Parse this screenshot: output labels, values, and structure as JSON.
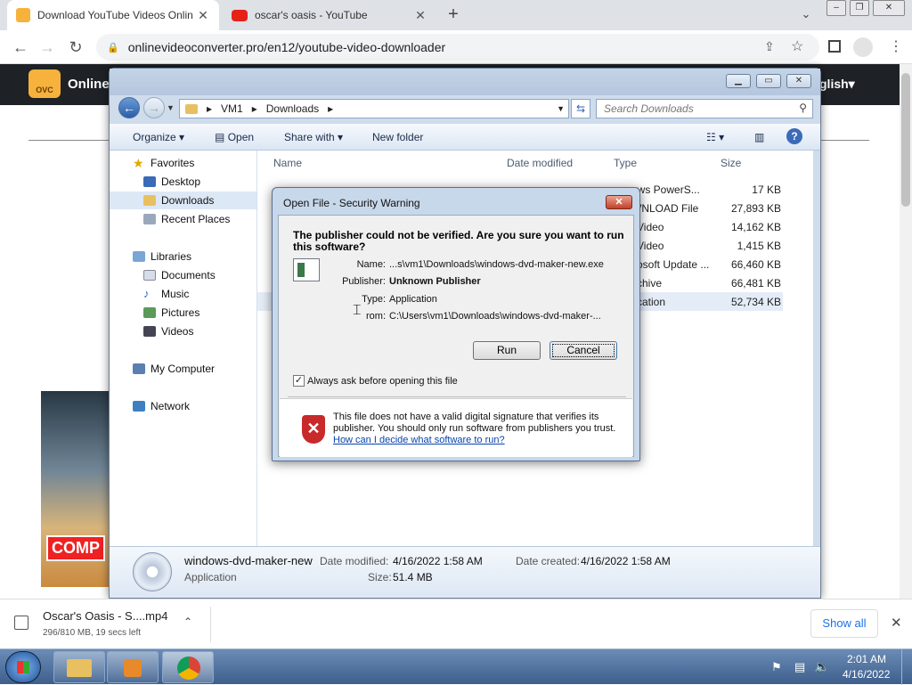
{
  "browser": {
    "tabs": [
      {
        "title": "Download YouTube Videos Onlin"
      },
      {
        "title": "oscar's oasis - YouTube"
      }
    ],
    "new_tab": "+",
    "url": "onlinevideoconverter.pro/en12/youtube-video-downloader",
    "window_controls": [
      "–",
      "❐",
      "✕"
    ]
  },
  "site": {
    "logo_text": "OVC",
    "brand": "Online",
    "lang": "glish",
    "video_label": "COMP"
  },
  "explorer": {
    "path": [
      "VM1",
      "Downloads"
    ],
    "search_placeholder": "Search Downloads",
    "commands": {
      "organize": "Organize",
      "open": "Open",
      "share_with": "Share with",
      "new_folder": "New folder"
    },
    "nav": {
      "favorites": "Favorites",
      "desktop": "Desktop",
      "downloads": "Downloads",
      "recent_places": "Recent Places",
      "libraries": "Libraries",
      "documents": "Documents",
      "music": "Music",
      "pictures": "Pictures",
      "videos": "Videos",
      "my_computer": "My Computer",
      "network": "Network"
    },
    "columns": {
      "name": "Name",
      "date_modified": "Date modified",
      "type": "Type",
      "size": "Size"
    },
    "files": [
      {
        "type": "ows PowerS...",
        "size": "17 KB"
      },
      {
        "type": "WNLOAD File",
        "size": "27,893 KB"
      },
      {
        "type": "Video",
        "size": "14,162 KB"
      },
      {
        "type": "Video",
        "size": "1,415 KB"
      },
      {
        "type": "osoft Update ...",
        "size": "66,460 KB"
      },
      {
        "type": "chive",
        "size": "66,481 KB"
      },
      {
        "type": "cation",
        "size": "52,734 KB"
      }
    ],
    "details": {
      "name": "windows-dvd-maker-new",
      "kind": "Application",
      "date_modified_label": "Date modified:",
      "date_modified": "4/16/2022 1:58 AM",
      "date_created_label": "Date created:",
      "date_created": "4/16/2022 1:58 AM",
      "size_label": "Size:",
      "size": "51.4 MB"
    }
  },
  "dialog": {
    "title": "Open File - Security Warning",
    "question": "The publisher could not be verified.  Are you sure you want to run this software?",
    "name_label": "Name:",
    "name_value": "...s\\vm1\\Downloads\\windows-dvd-maker-new.exe",
    "publisher_label": "Publisher:",
    "publisher_value": "Unknown Publisher",
    "type_label": "Type:",
    "type_value": "Application",
    "from_label": "rom:",
    "from_value": "C:\\Users\\vm1\\Downloads\\windows-dvd-maker-...",
    "run": "Run",
    "cancel": "Cancel",
    "always_ask": "Always ask before opening this file",
    "warning": "This file does not have a valid digital signature that verifies its publisher.  You should only run software from publishers you trust.",
    "help_link": "How can I decide what software to run?"
  },
  "shelf": {
    "file": "Oscar's Oasis - S....mp4",
    "progress": "296/810 MB, 19 secs left",
    "show_all": "Show all"
  },
  "taskbar": {
    "time": "2:01 AM",
    "date": "4/16/2022"
  }
}
